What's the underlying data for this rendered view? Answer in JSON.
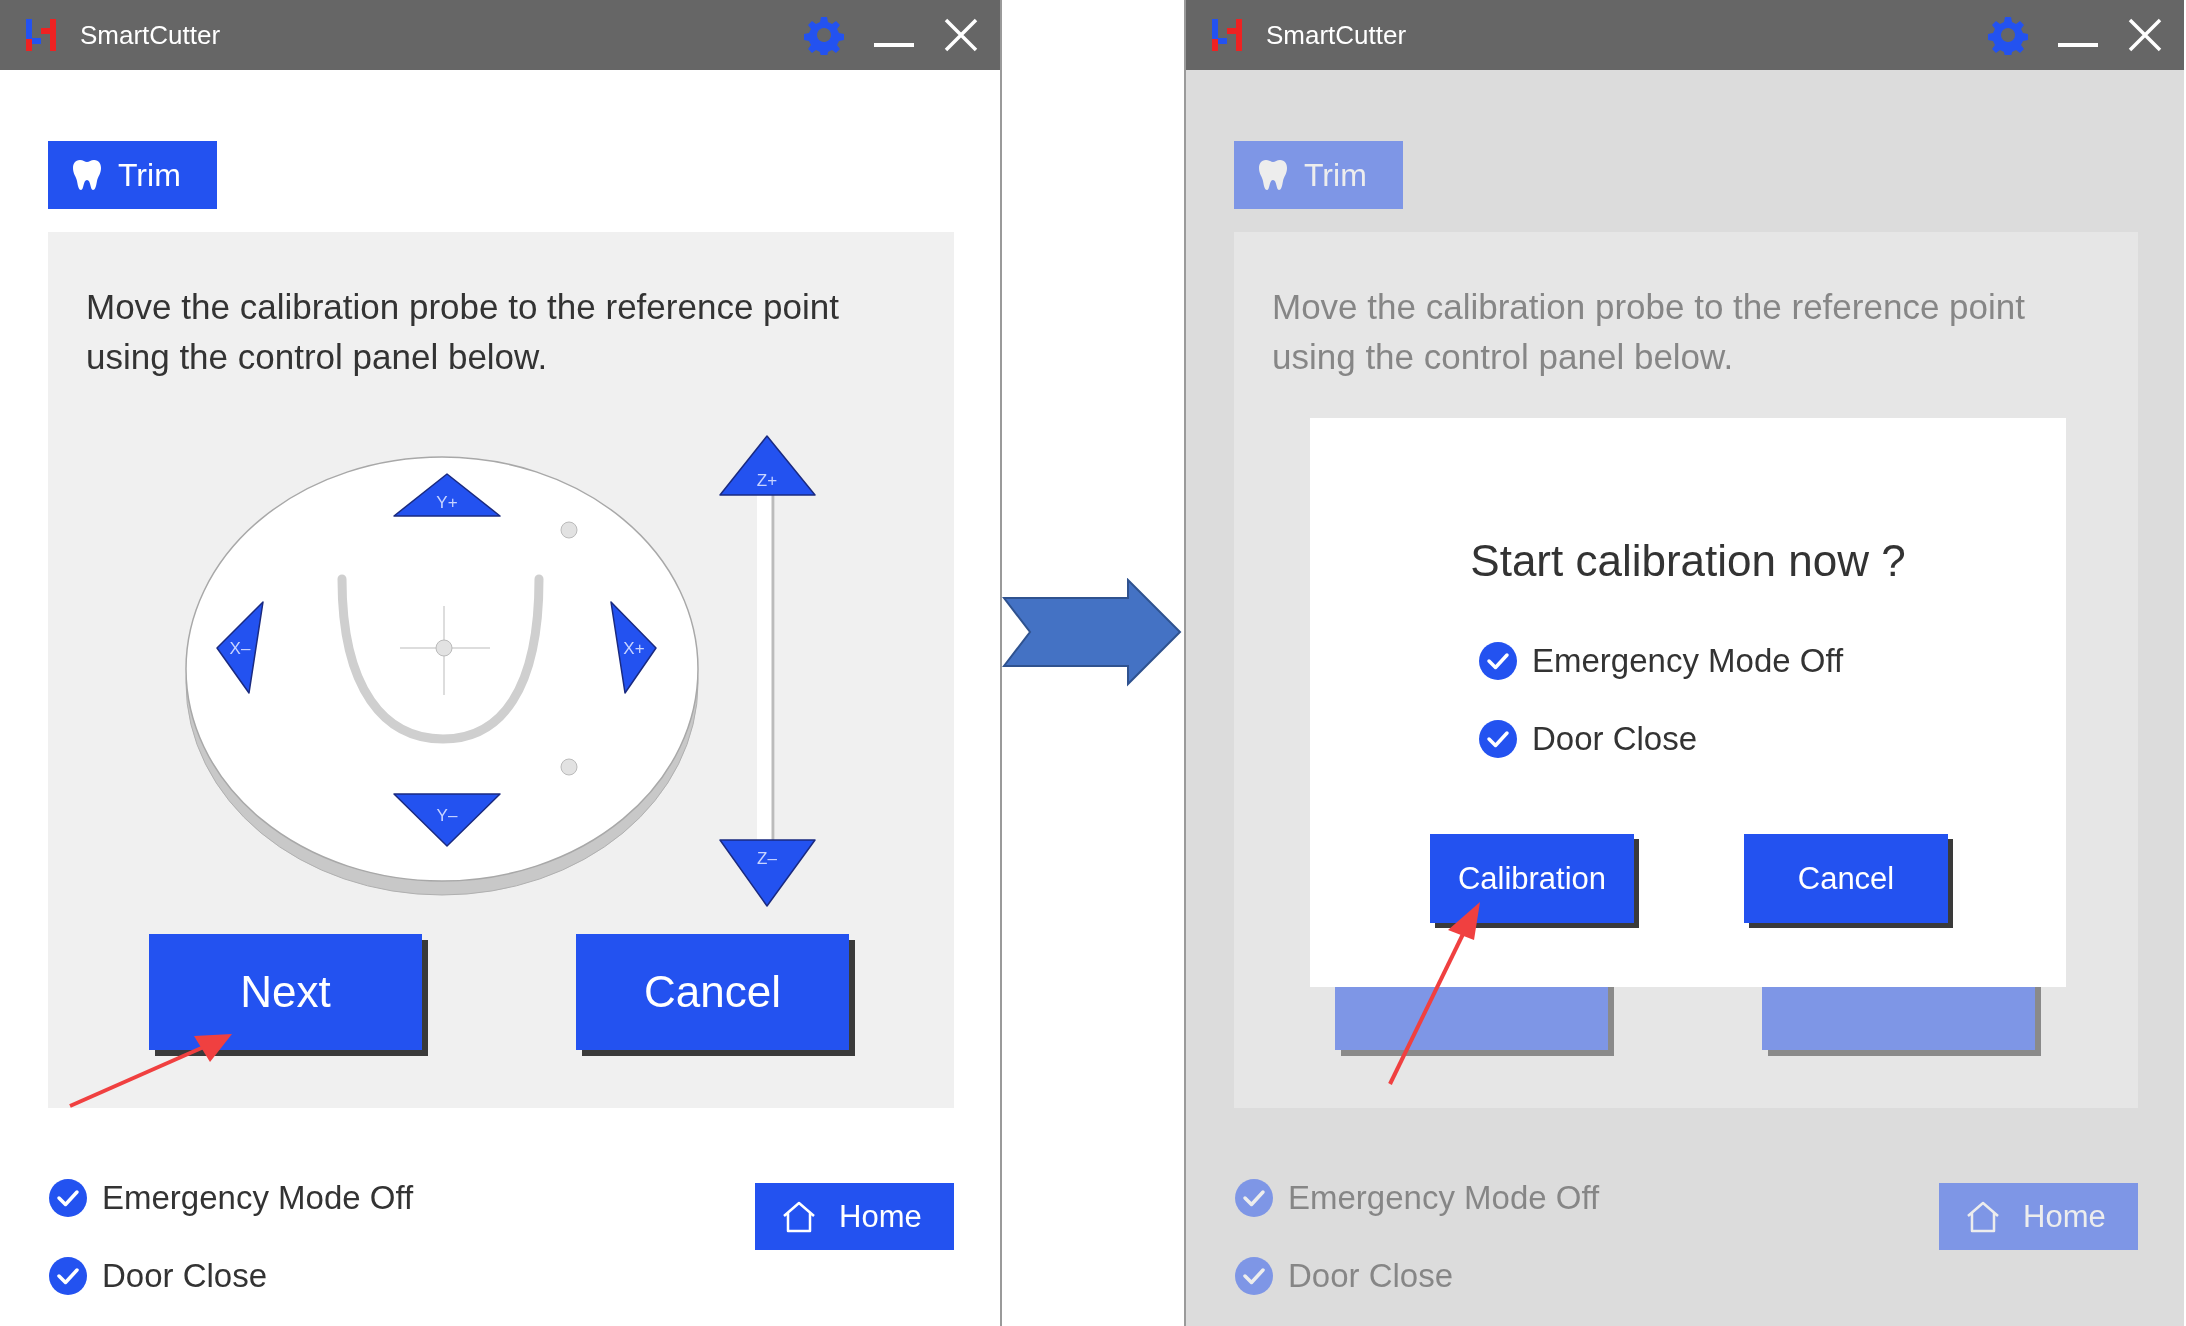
{
  "windows": [
    {
      "title": "SmartCutter",
      "dimmed": false,
      "tab": {
        "label": "Trim"
      },
      "instruction": "Move the calibration probe to the reference point using the control panel below.",
      "pad": {
        "y_plus": "Y+",
        "x_minus": "X–",
        "x_plus": "X+",
        "y_minus": "Y–",
        "z_plus": "Z+",
        "z_minus": "Z–"
      },
      "buttons": [
        {
          "label": "Next"
        },
        {
          "label": "Cancel"
        }
      ],
      "status": [
        {
          "label": "Emergency Mode Off",
          "checked": true
        },
        {
          "label": "Door Close",
          "checked": true
        }
      ],
      "home": {
        "label": "Home"
      }
    },
    {
      "title": "SmartCutter",
      "dimmed": true,
      "tab": {
        "label": "Trim"
      },
      "instruction": "Move the calibration probe to the reference point using the control panel below.",
      "blank_buttons": true,
      "status": [
        {
          "label": "Emergency Mode Off",
          "checked": true
        },
        {
          "label": "Door Close",
          "checked": true
        }
      ],
      "home": {
        "label": "Home"
      },
      "dialog": {
        "title": "Start calibration now ?",
        "checks": [
          {
            "label": "Emergency Mode Off",
            "checked": true
          },
          {
            "label": "Door Close",
            "checked": true
          }
        ],
        "buttons": [
          {
            "label": "Calibration"
          },
          {
            "label": "Cancel"
          }
        ]
      }
    }
  ]
}
